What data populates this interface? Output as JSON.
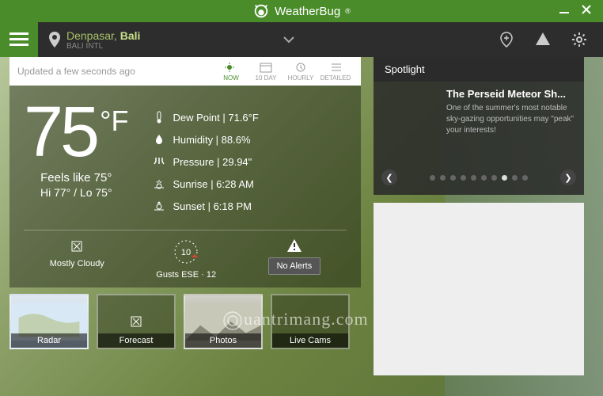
{
  "header": {
    "app_name": "WeatherBug",
    "registered_mark": "®"
  },
  "location": {
    "city": "Denpasar,",
    "region": "Bali",
    "station": "BALI INTL"
  },
  "tabs": {
    "updated_text": "Updated a few seconds ago",
    "now": "NOW",
    "tenday": "10 DAY",
    "hourly": "HOURLY",
    "detailed": "DETAILED"
  },
  "weather": {
    "temp_value": "75",
    "temp_unit": "°F",
    "feels_like": "Feels like 75°",
    "hilo": "Hi 77° / Lo 75°",
    "dew_point": "Dew Point  |  71.6°F",
    "humidity": "Humidity  |  88.6%",
    "pressure": "Pressure  |  29.94\"",
    "sunrise": "Sunrise  |  6:28 AM",
    "sunset": "Sunset  |  6:18 PM",
    "condition": "Mostly Cloudy",
    "wind_value": "10",
    "wind_text": "Gusts ESE · 12",
    "alerts": "No Alerts"
  },
  "thumbs": {
    "radar": "Radar",
    "forecast": "Forecast",
    "photos": "Photos",
    "livecams": "Live Cams"
  },
  "spotlight": {
    "header": "Spotlight",
    "title": "The Perseid Meteor Sh...",
    "desc": "One of the summer's most notable sky-gazing opportunities may \"peak\" your interests!"
  },
  "watermark": "uantrimang"
}
